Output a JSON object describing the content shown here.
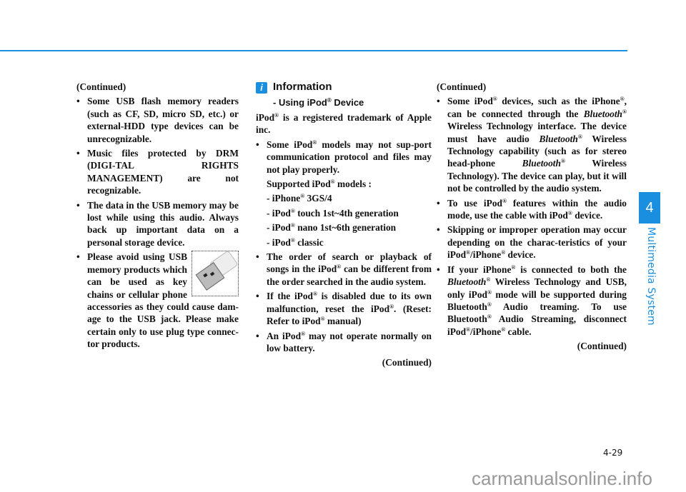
{
  "page": {
    "page_number": "4-29",
    "chapter_number": "4",
    "chapter_title": "Multimedia System",
    "watermark": "carmanualsonline.info",
    "accent_color": "#1a8fe0"
  },
  "col1": {
    "continued": "(Continued)",
    "bullets": [
      "Some USB flash memory readers (such as CF, SD, micro SD, etc.) or external-HDD type devices can be unrecognizable.",
      "Music files protected by DRM (DIGI-TAL RIGHTS MANAGEMENT) are not recognizable.",
      "The data in the USB memory may be lost while using this audio. Always back up important data on a personal storage device.",
      "Please avoid using USB memory products which can be used as key chains or cellular phone accessories as they could cause dam-age to the USB jack. Please make certain only to use plug type connec-tor products."
    ],
    "image_icon": "usb-flash-drive-icon"
  },
  "col2": {
    "info_icon": "i",
    "title": "Information",
    "subtitle": "- Using iPod® Device",
    "intro": "iPod® is a registered trademark of Apple inc.",
    "bullet1": "Some iPod® models may not sup-port communication protocol and files may not play properly.",
    "supported_label": "Supported iPod® models :",
    "models": [
      "- iPhone® 3GS/4",
      "- iPod® touch 1st~4th generation",
      "- iPod® nano 1st~6th generation",
      "- iPod® classic"
    ],
    "bullets": [
      "The order of search or playback of songs in the iPod® can be different from the order searched in the audio system.",
      "If the iPod® is disabled due to its own malfunction, reset the iPod®. (Reset: Refer to iPod® manual)",
      "An iPod® may not operate normally on low battery."
    ],
    "continued": "(Continued)"
  },
  "col3": {
    "continued_top": "(Continued)",
    "bullets": [
      "Some iPod® devices, such as the iPhone®, can be connected through the Bluetooth® Wireless Technology interface. The device must have audio Bluetooth® Wireless Technology capability (such as for stereo head-phone Bluetooth® Wireless Technology). The device can play, but it will not be controlled by the audio system.",
      "To use iPod® features within the audio mode, use the cable with iPod® device.",
      "Skipping or improper operation may occur depending on the charac-teristics of your iPod®/iPhone® device.",
      "If your iPhone® is connected to both the Bluetooth® Wireless Technology and USB, only iPod® mode will be supported during Bluetooth® Audio treaming. To use Bluetooth® Audio Streaming, disconnect iPod®/iPhone® cable."
    ],
    "continued_bottom": "(Continued)"
  }
}
